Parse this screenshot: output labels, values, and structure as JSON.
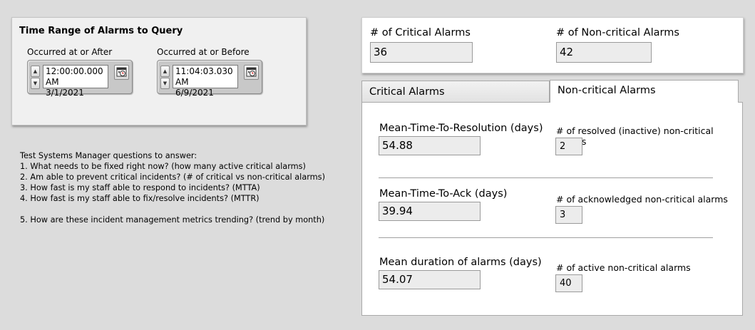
{
  "time_range": {
    "title": "Time Range of Alarms to Query",
    "after": {
      "label": "Occurred at or After",
      "time": "12:00:00.000 AM",
      "date": "3/1/2021"
    },
    "before": {
      "label": "Occurred at or Before",
      "time": "11:04:03.030 AM",
      "date": "6/9/2021"
    }
  },
  "questions": {
    "heading": "Test Systems Manager questions to answer:",
    "q1": "1. What needs to be fixed right now?  (how many active critical alarms)",
    "q2": "2. Am able to prevent critical incidents? (# of critical vs non-critical alarms)",
    "q3": "3. How fast is my staff able to respond to incidents? (MTTA)",
    "q4": "4. How fast is my staff able to fix/resolve incidents? (MTTR)",
    "q5": "5. How are these incident management metrics trending? (trend by month)"
  },
  "counts": {
    "critical_label": "# of Critical Alarms",
    "critical_value": "36",
    "noncritical_label": "# of Non-critical Alarms",
    "noncritical_value": "42"
  },
  "tabs": {
    "critical": "Critical Alarms",
    "noncritical": "Non-critical Alarms"
  },
  "metrics": {
    "mttr_label": "Mean-Time-To-Resolution (days)",
    "mttr_value": "54.88",
    "resolved_label": "# of resolved (inactive) non-critical alarms",
    "resolved_value": "2",
    "mtta_label": "Mean-Time-To-Ack (days)",
    "mtta_value": "39.94",
    "ack_label": "# of acknowledged non-critical alarms",
    "ack_value": "3",
    "duration_label": "Mean duration of alarms (days)",
    "duration_value": "54.07",
    "active_label": "# of active non-critical alarms",
    "active_value": "40"
  }
}
